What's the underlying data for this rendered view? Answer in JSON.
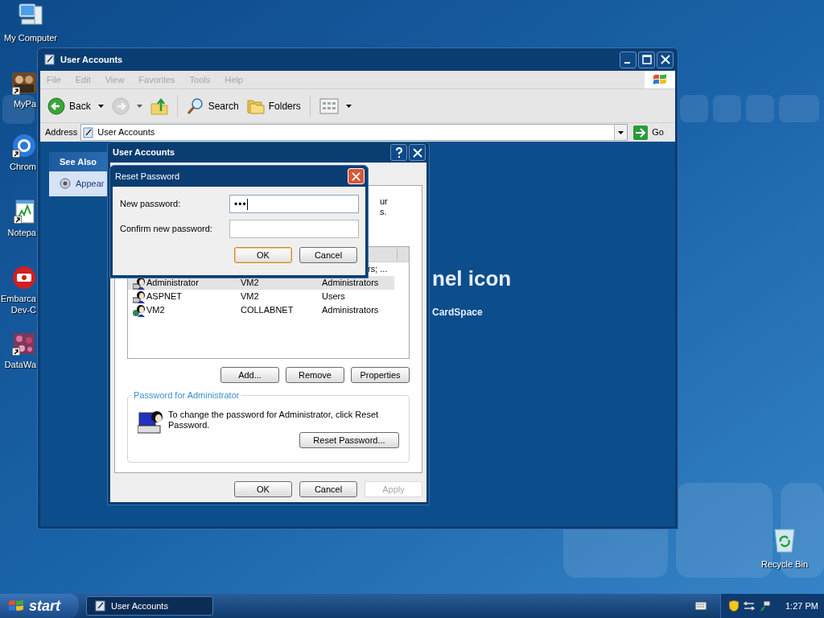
{
  "desktop_icons": [
    {
      "kind": "computer",
      "lines": [
        "My Computer"
      ],
      "shortcut": false
    },
    {
      "kind": "photo",
      "lines": [
        "MyPa"
      ],
      "shortcut": true
    },
    {
      "kind": "chrome",
      "lines": [
        "Chrom"
      ],
      "shortcut": true
    },
    {
      "kind": "notepad",
      "lines": [
        "Notepa"
      ],
      "shortcut": true
    },
    {
      "kind": "devtool",
      "lines": [
        "Embarca",
        "Dev-C"
      ],
      "shortcut": false
    },
    {
      "kind": "datawave",
      "lines": [
        "DataWa"
      ],
      "shortcut": true
    }
  ],
  "recycle_bin": {
    "label": "Recycle Bin"
  },
  "explorer": {
    "title": "User Accounts",
    "menu": [
      {
        "label": "File",
        "disabled": true
      },
      {
        "label": "Edit",
        "disabled": true
      },
      {
        "label": "View",
        "disabled": true
      },
      {
        "label": "Favorites",
        "disabled": true
      },
      {
        "label": "Tools",
        "disabled": true
      },
      {
        "label": "Help",
        "disabled": true
      }
    ],
    "toolbar": [
      {
        "kind": "back",
        "label": "Back",
        "disabled": false
      },
      {
        "kind": "forward",
        "disabled": true
      },
      {
        "kind": "up",
        "disabled": false
      },
      {
        "kind": "search",
        "label": "Search",
        "disabled": false
      },
      {
        "kind": "folders",
        "label": "Folders",
        "disabled": false
      },
      {
        "kind": "views",
        "disabled": false
      }
    ],
    "address": {
      "label": "Address",
      "value": "User Accounts",
      "go": "Go"
    },
    "see_also": {
      "title": "See Also",
      "items": [
        "Appear"
      ]
    },
    "heading": "nel icon",
    "link": "CardSpace"
  },
  "accounts_dialog": {
    "title": "User Accounts",
    "intro_fragments": [
      "ur",
      "s."
    ],
    "partial_row": "rs; ...",
    "users": [
      {
        "name": "Administrator",
        "domain": "VM2",
        "group": "Administrators",
        "kind": "local",
        "selected": true
      },
      {
        "name": "ASPNET",
        "domain": "VM2",
        "group": "Users",
        "kind": "local",
        "selected": false
      },
      {
        "name": "VM2",
        "domain": "COLLABNET",
        "group": "Administrators",
        "kind": "domain",
        "selected": false
      }
    ],
    "buttons": [
      {
        "label": "Add..."
      },
      {
        "label": "Remove"
      },
      {
        "label": "Properties"
      }
    ],
    "password_group": {
      "title": "Password for Administrator",
      "text": "To change the password for Administrator, click Reset Password.",
      "button": "Reset Password..."
    },
    "footer_buttons": [
      {
        "label": "OK",
        "disabled": false
      },
      {
        "label": "Cancel",
        "disabled": false
      },
      {
        "label": "Apply",
        "disabled": true
      }
    ]
  },
  "reset_dialog": {
    "title": "Reset Password",
    "fields": [
      {
        "label": "New password:",
        "value": "•••",
        "focused": true
      },
      {
        "label": "Confirm new password:",
        "focused": false
      }
    ],
    "buttons": [
      {
        "label": "OK",
        "default": true
      },
      {
        "label": "Cancel",
        "default": false
      }
    ]
  },
  "taskbar": {
    "start": "start",
    "tasks": [
      {
        "label": "User Accounts",
        "selected": true
      }
    ],
    "clock": "1:27 PM"
  }
}
